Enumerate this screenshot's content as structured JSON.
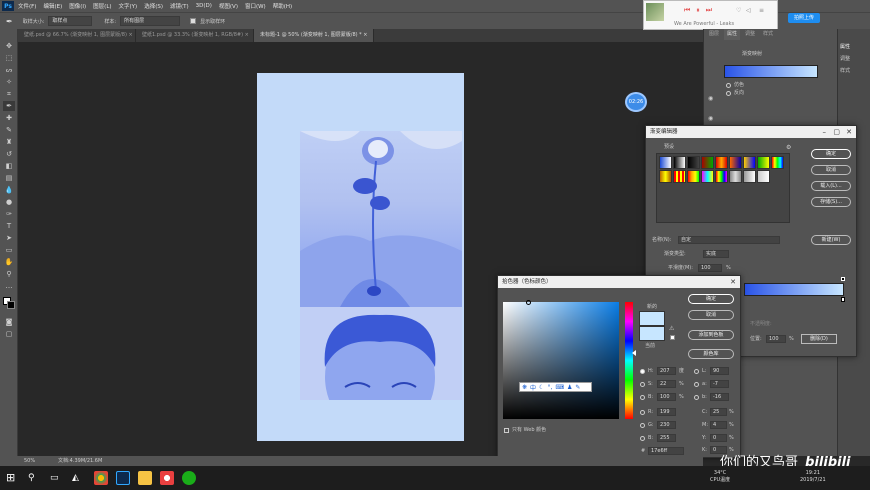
{
  "menubar": {
    "app_logo": "Ps",
    "items": [
      "文件(F)",
      "编辑(E)",
      "图像(I)",
      "图层(L)",
      "文字(Y)",
      "选择(S)",
      "滤镜(T)",
      "3D(D)",
      "视图(V)",
      "窗口(W)",
      "帮助(H)"
    ]
  },
  "options": {
    "sample_size_label": "取样大小:",
    "sample_size_value": "取样点",
    "sample_label": "样本:",
    "sample_value": "所有图层",
    "show_ring_label": "显示取样环"
  },
  "tabs": [
    {
      "label": "壁纸.psd @ 66.7% (渐变映射 1, 图层蒙版/8) ×",
      "active": false
    },
    {
      "label": "壁纸1.psd @ 33.3% (渐变映射 1, RGB/8#) ×",
      "active": false
    },
    {
      "label": "未标题-1 @ 50% (渐变映射 1, 图层蒙版/8) * ×",
      "active": true
    }
  ],
  "status": {
    "zoom": "50%",
    "doc_info": "文档:4.39M/21.6M"
  },
  "music_player": {
    "song": "We Are Powerful - Leaks"
  },
  "timer": "02:26",
  "right_panel": {
    "tabs": [
      "图层",
      "属性",
      "调整",
      "样式"
    ],
    "properties_label": "渐变映射",
    "dither": "仿色",
    "reverse": "反向"
  },
  "right_strip": {
    "items": [
      "属性",
      "调整",
      "样式"
    ]
  },
  "upload_button": "拍照上传",
  "gradient_editor": {
    "title": "渐变编辑器",
    "presets_label": "预设",
    "ok": "确定",
    "cancel": "取消",
    "load": "载入(L)...",
    "save": "存储(S)...",
    "name_label": "名称(N):",
    "name_value": "自定",
    "new": "新建(W)",
    "type_label": "渐变类型:",
    "type_value": "实底",
    "smooth_label": "平滑度(M):",
    "smooth_value": "100",
    "smooth_unit": "%",
    "stop_label": "色标",
    "opacity_label": "不透明度:",
    "pos_label": "位置:",
    "pos_value": "100",
    "delete_label": "删除(D)"
  },
  "color_picker": {
    "title": "拾色器（色标颜色）",
    "new_label": "新的",
    "current_label": "当前",
    "ok": "确定",
    "cancel": "取消",
    "add_swatch": "添加到色板",
    "libraries": "颜色库",
    "web_only": "只有 Web 颜色",
    "fields": [
      {
        "k": "H:",
        "v": "207",
        "u": "度"
      },
      {
        "k": "S:",
        "v": "22",
        "u": "%"
      },
      {
        "k": "B:",
        "v": "100",
        "u": "%"
      },
      {
        "k": "R:",
        "v": "199",
        "u": ""
      },
      {
        "k": "G:",
        "v": "230",
        "u": ""
      },
      {
        "k": "B:",
        "v": "255",
        "u": ""
      }
    ],
    "lab": [
      {
        "k": "L:",
        "v": "90"
      },
      {
        "k": "a:",
        "v": "-7"
      },
      {
        "k": "b:",
        "v": "-16"
      },
      {
        "k": "C:",
        "v": "25",
        "u": "%"
      },
      {
        "k": "M:",
        "v": "4",
        "u": "%"
      },
      {
        "k": "Y:",
        "v": "0",
        "u": "%"
      },
      {
        "k": "K:",
        "v": "0",
        "u": "%"
      }
    ],
    "hex_label": "#",
    "hex_value": "17e6ff",
    "new_color": "#c7e6ff",
    "current_color": "#c7e6ff",
    "ime_label": "中"
  },
  "watermark": "你们的又鸟哥",
  "watermark_logo": "bilibili",
  "taskbar": {
    "temp": "34°C",
    "cpu_label": "CPU温度",
    "time": "19:21",
    "date": "2019/7/21"
  },
  "colors": {
    "accent": "#1473e6",
    "doc_bg": "#c3daf9",
    "gradient_start": "#2a54e8",
    "gradient_end": "#c7e6ff"
  }
}
